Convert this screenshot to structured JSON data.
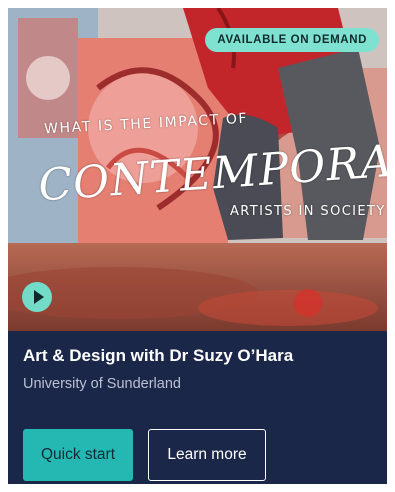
{
  "card": {
    "badge": "AVAILABLE ON DEMAND",
    "hero_text": {
      "line1": "WHAT IS THE IMPACT OF",
      "main": "CONTEMPORARY",
      "line3": "ARTISTS IN SOCIETY?"
    },
    "title": "Art & Design with Dr Suzy O’Hara",
    "subtitle": "University of Sunderland",
    "buttons": {
      "quick_start": "Quick start",
      "learn_more": "Learn more"
    }
  },
  "colors": {
    "card_background": "#1a2748",
    "accent_teal": "#25b8b2",
    "badge_background": "#7fe2d0",
    "play_button": "#72dcc8"
  },
  "icons": {
    "play": "play-icon"
  }
}
